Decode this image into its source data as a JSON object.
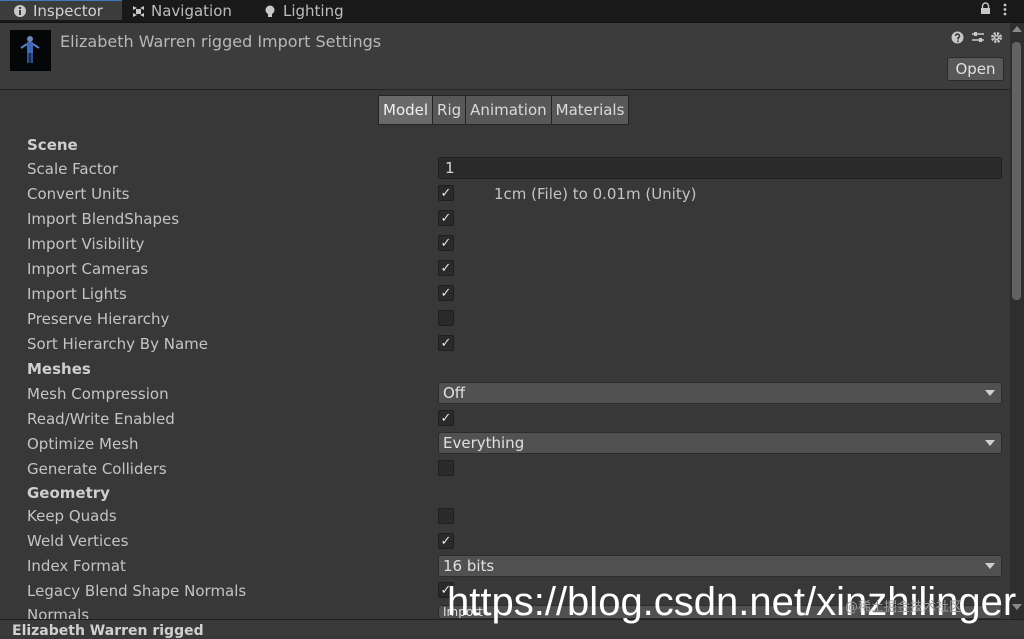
{
  "tabs": [
    {
      "label": "Inspector",
      "icon": "info-icon",
      "active": true
    },
    {
      "label": "Navigation",
      "icon": "navigation-icon",
      "active": false
    },
    {
      "label": "Lighting",
      "icon": "lightbulb-icon",
      "active": false
    }
  ],
  "header": {
    "title": "Elizabeth Warren rigged Import Settings",
    "open_label": "Open"
  },
  "subtabs": [
    "Model",
    "Rig",
    "Animation",
    "Materials"
  ],
  "selected_subtab": "Model",
  "scene": {
    "heading": "Scene",
    "scale_factor_label": "Scale Factor",
    "scale_factor_value": "1",
    "convert_units_label": "Convert Units",
    "convert_units_note": "1cm (File) to 0.01m (Unity)",
    "import_blendshapes_label": "Import BlendShapes",
    "import_visibility_label": "Import Visibility",
    "import_cameras_label": "Import Cameras",
    "import_lights_label": "Import Lights",
    "preserve_hierarchy_label": "Preserve Hierarchy",
    "sort_hierarchy_label": "Sort Hierarchy By Name"
  },
  "meshes": {
    "heading": "Meshes",
    "mesh_compression_label": "Mesh Compression",
    "mesh_compression_value": "Off",
    "read_write_label": "Read/Write Enabled",
    "optimize_mesh_label": "Optimize Mesh",
    "optimize_mesh_value": "Everything",
    "generate_colliders_label": "Generate Colliders"
  },
  "geometry": {
    "heading": "Geometry",
    "keep_quads_label": "Keep Quads",
    "weld_vertices_label": "Weld Vertices",
    "index_format_label": "Index Format",
    "index_format_value": "16 bits",
    "legacy_blend_label": "Legacy Blend Shape Normals",
    "normals_label": "Normals",
    "normals_value": "Import"
  },
  "checks": {
    "convert_units": true,
    "import_blendshapes": true,
    "import_visibility": true,
    "import_cameras": true,
    "import_lights": true,
    "preserve_hierarchy": false,
    "sort_hierarchy": true,
    "read_write": true,
    "generate_colliders": false,
    "keep_quads": false,
    "weld_vertices": true,
    "legacy_blend": true
  },
  "check_glyph": "✓",
  "footer_title": "Elizabeth Warren rigged",
  "watermark": "https://blog.csdn.net/xinzhilinger",
  "watermark_small": "@稀土掘金技术社区",
  "colors": {
    "active_tab_accent": "#3a79bb",
    "background": "#383838"
  }
}
